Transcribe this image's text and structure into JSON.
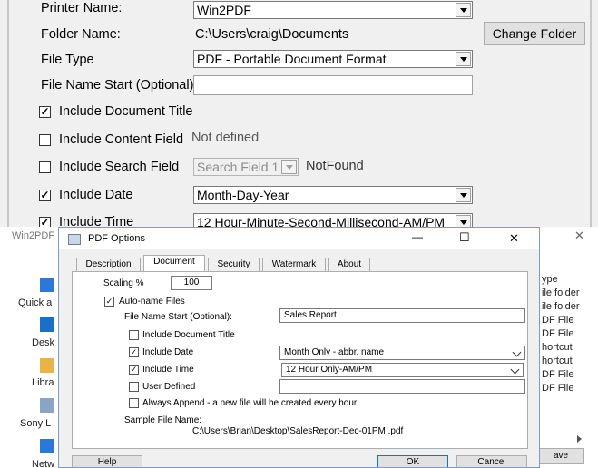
{
  "printer_dialog": {
    "printer_name_label": "Printer Name:",
    "printer_name_value": "Win2PDF",
    "folder_name_label": "Folder Name:",
    "folder_name_value": "C:\\Users\\craig\\Documents",
    "change_folder_button": "Change Folder",
    "file_type_label": "File Type",
    "file_type_value": "PDF - Portable Document Format",
    "file_name_start_label": "File Name Start (Optional):",
    "file_name_start_value": "",
    "include_document_title": {
      "label": "Include Document Title",
      "checked": true
    },
    "include_content_field": {
      "label": "Include Content Field",
      "checked": false,
      "status": "Not defined"
    },
    "include_search_field": {
      "label": "Include Search Field",
      "checked": false,
      "value": "Search Field 1",
      "status": "NotFound"
    },
    "include_date": {
      "label": "Include Date",
      "checked": true,
      "value": "Month-Day-Year"
    },
    "include_time": {
      "label": "Include Time",
      "checked": true,
      "value": "12 Hour-Minute-Second-Millisecond-AM/PM"
    }
  },
  "background_window": {
    "title": "Win2PDF",
    "left_items": [
      "Quick a",
      "Desk",
      "Libra",
      "Sony L",
      "Netw"
    ],
    "right_items": [
      "ype",
      "ile folder",
      "ile folder",
      "DF File",
      "DF File",
      "hortcut",
      "hortcut",
      "DF File",
      "DF File"
    ],
    "save_button": "ave",
    "close_glyph": "✕"
  },
  "pdf_options": {
    "title": "PDF Options",
    "tabs": [
      "Description",
      "Document",
      "Security",
      "Watermark",
      "About"
    ],
    "active_tab": "Document",
    "scaling_label": "Scaling %",
    "scaling_value": "100",
    "auto_name": {
      "label": "Auto-name Files",
      "checked": true
    },
    "file_name_start_label": "File Name Start (Optional):",
    "file_name_start_value": "Sales Report",
    "include_document_title": {
      "label": "Include Document Title",
      "checked": false
    },
    "include_date": {
      "label": "Include Date",
      "checked": true,
      "value": "Month Only - abbr. name"
    },
    "include_time": {
      "label": "Include Time",
      "checked": true,
      "value": "12 Hour Only-AM/PM"
    },
    "user_defined": {
      "label": "User Defined",
      "checked": false,
      "value": ""
    },
    "always_append": {
      "label": "Always Append - a new file will be created every hour",
      "checked": false
    },
    "sample_label": "Sample File Name:",
    "sample_value": "C:\\Users\\Brian\\Desktop\\SalesReport-Dec-01PM .pdf",
    "help_button": "Help",
    "ok_button": "OK",
    "cancel_button": "Cancel",
    "minimize_glyph": "—",
    "maximize_glyph": "☐",
    "close_glyph": "✕"
  }
}
